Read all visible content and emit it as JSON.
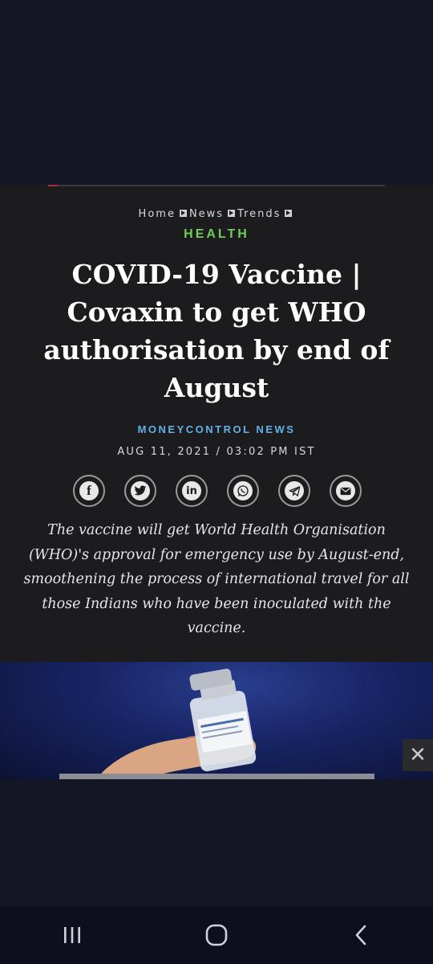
{
  "breadcrumb": {
    "items": [
      "Home",
      "News",
      "Trends"
    ]
  },
  "category": "HEALTH",
  "headline": "COVID-19 Vaccine | Covaxin to get WHO authorisation by end of August",
  "author": "MONEYCONTROL NEWS",
  "date": "AUG 11, 2021 / 03:02 PM IST",
  "share": [
    {
      "icon": "facebook-icon",
      "glyph": "f"
    },
    {
      "icon": "twitter-icon",
      "glyph": ""
    },
    {
      "icon": "linkedin-icon",
      "glyph": "in"
    },
    {
      "icon": "whatsapp-icon",
      "glyph": ""
    },
    {
      "icon": "telegram-icon",
      "glyph": ""
    },
    {
      "icon": "email-icon",
      "glyph": ""
    }
  ],
  "summary": "The vaccine will get World Health Organisation (WHO)'s approval for emergency use by August-end, smoothening the process of international travel for all those Indians who have been inoculated with the vaccine.",
  "ad": {
    "close_glyph": "✕"
  },
  "colors": {
    "page_background": "#141626",
    "article_background": "#1c1c1e",
    "category": "#6fce5b",
    "author": "#5fb3e8"
  }
}
